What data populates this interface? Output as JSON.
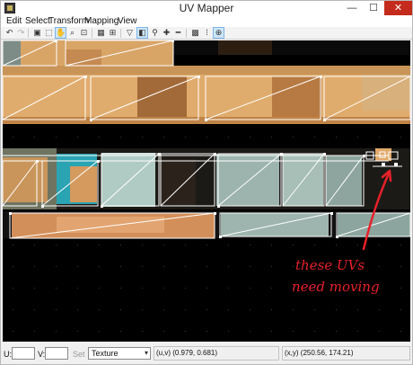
{
  "window": {
    "title": "UV Mapper",
    "minimize_glyph": "—",
    "maximize_glyph": "☐",
    "close_glyph": "✕"
  },
  "menu": [
    {
      "label": "Edit",
      "underline": "E"
    },
    {
      "label": "Select",
      "underline": "S"
    },
    {
      "label": "Transform",
      "underline": "T"
    },
    {
      "label": "Mapping",
      "underline": "M"
    },
    {
      "label": "View",
      "underline": "V"
    }
  ],
  "toolbar": {
    "icons": [
      "undo-icon",
      "redo-icon",
      "show-image-icon",
      "select-icon",
      "hand-pan-icon",
      "zoom-icon",
      "zoom-region-icon",
      "snap-icon",
      "grid-snap-icon",
      "filter-icon",
      "split-view-icon",
      "weld-icon",
      "add-icon",
      "remove-icon",
      "grid-icon",
      "grid-dots-icon",
      "target-icon"
    ],
    "active": [
      "hand-pan-icon",
      "split-view-icon",
      "target-icon"
    ]
  },
  "annotation": {
    "text_line1": "these UVs",
    "text_line2": "need moving",
    "color": "#e8212a"
  },
  "statusbar": {
    "u_label": "U:",
    "v_label": "V:",
    "set_label": "Set",
    "mode_value": "Texture",
    "uv_readout": "(u,v) (0.979, 0.681)",
    "xy_readout": "(x,y) (250.56, 174.21)"
  },
  "colors": {
    "canvas_bg": "#000000",
    "uv_line": "#ffffff",
    "selection_tint": "#a9c8c3",
    "close_button": "#c42b1c"
  }
}
